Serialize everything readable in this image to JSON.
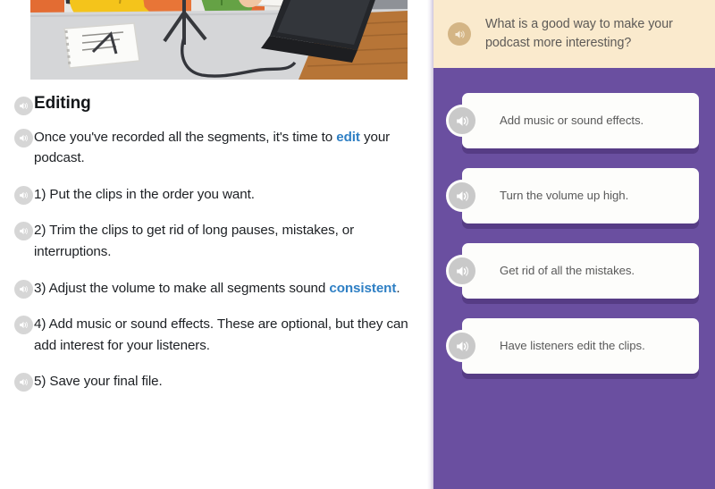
{
  "article": {
    "illustration_alt": "Watercolor illustration of people recording a podcast at a table with a microphone on a tripod, a laptop, and a notebook",
    "blocks": [
      {
        "type": "heading",
        "text": "Editing",
        "icon": "speaker-icon"
      },
      {
        "type": "paragraph",
        "pre": "Once you've recorded all the segments, it's time to ",
        "link": "edit",
        "post": " your podcast.",
        "icon": "speaker-icon"
      },
      {
        "type": "paragraph",
        "pre": "1) Put the clips in the order you want.",
        "link": "",
        "post": "",
        "icon": "speaker-icon"
      },
      {
        "type": "paragraph",
        "pre": "2) Trim the clips to get rid of long pauses, mistakes, or interruptions.",
        "link": "",
        "post": "",
        "icon": "speaker-icon"
      },
      {
        "type": "paragraph",
        "pre": "3) Adjust the volume to make all segments sound ",
        "link": "consistent",
        "post": ".",
        "icon": "speaker-icon"
      },
      {
        "type": "paragraph",
        "pre": "4) Add music or sound effects. These are optional, but they can add interest for your listeners.",
        "link": "",
        "post": "",
        "icon": "speaker-icon"
      },
      {
        "type": "paragraph",
        "pre": "5) Save your final file.",
        "link": "",
        "post": "",
        "icon": "speaker-icon"
      }
    ]
  },
  "quiz": {
    "question": {
      "text": "What is a good way to make your podcast more interesting?",
      "icon": "speaker-icon"
    },
    "options": [
      {
        "text": "Add music or sound effects.",
        "icon": "speaker-icon"
      },
      {
        "text": "Turn the volume up high.",
        "icon": "speaker-icon"
      },
      {
        "text": "Get rid of all the mistakes.",
        "icon": "speaker-icon"
      },
      {
        "text": "Have listeners edit the clips.",
        "icon": "speaker-icon"
      }
    ]
  },
  "colors": {
    "panel_purple": "#6a4fa0",
    "question_cream": "#faeacd",
    "question_icon": "#d4b585",
    "link_blue": "#2e7fc4",
    "speaker_gray": "#d6d6d6",
    "card_white": "#fdfdfb"
  }
}
